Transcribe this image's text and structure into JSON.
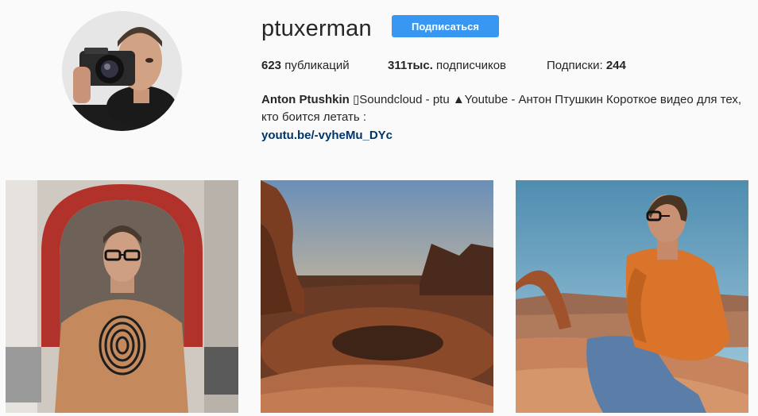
{
  "profile": {
    "username": "ptuxerman",
    "follow_label": "Подписаться",
    "stats": {
      "posts_count": "623",
      "posts_label": " публикаций",
      "followers_count": "311тыс.",
      "followers_label": " подписчиков",
      "following_label": "Подписки: ",
      "following_count": "244"
    },
    "bio": {
      "name": "Anton Ptushkin",
      "text": " ▯Soundcloud - ptu ▲Youtube - Антон Птушкин Короткое видео для тех, кто боится летать :",
      "link": "youtu.be/-vyheMu_DYc"
    }
  },
  "colors": {
    "accent": "#3897f0",
    "link": "#003569",
    "background": "#fafafa"
  },
  "icons": [
    "avatar-photo",
    "post-photo"
  ]
}
